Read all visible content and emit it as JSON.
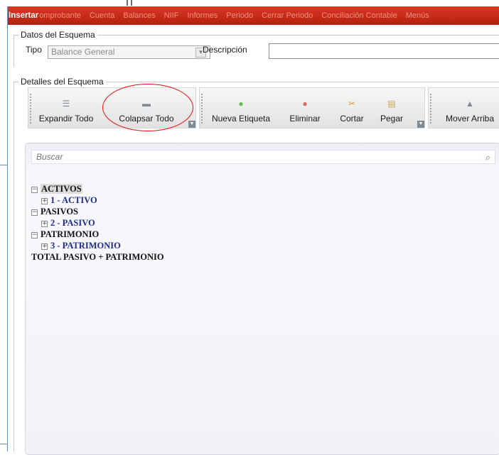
{
  "menubar": {
    "active": "Insertar",
    "items": [
      "omprobante",
      "Cuenta",
      "Balances",
      "NIIF",
      "Informes",
      "Periodo",
      "Cerrar Periodo",
      "Conciliación Contable",
      "Menús"
    ]
  },
  "datos": {
    "title": "Datos del Esquema",
    "tipo_label": "Tipo",
    "tipo_value": "Balance General",
    "descripcion_label": "Descripción",
    "descripcion_value": ""
  },
  "detalles": {
    "title": "Detalles del Esquema",
    "toolbar": {
      "expandir": "Expandir Todo",
      "colapsar": "Colapsar Todo",
      "nueva": "Nueva Etiqueta",
      "eliminar": "Eliminar",
      "cortar": "Cortar",
      "pegar": "Pegar",
      "mover_arriba": "Mover Arriba"
    },
    "search_placeholder": "Buscar",
    "tree": {
      "activos": "ACTIVOS",
      "activo": "1 - ACTIVO",
      "pasivos": "PASIVOS",
      "pasivo": "2 - PASIVO",
      "patrimonio": "PATRIMONIO",
      "patrimonio_child": "3 - PATRIMONIO",
      "total": "TOTAL PASIVO + PATRIMONIO"
    }
  },
  "colors": {
    "menubar": "#c52a15",
    "annotation": "#e81010",
    "tree_child": "#1f2c8f"
  },
  "icons": {
    "collapsed_node": "plus-box",
    "expanded_node": "minus-box"
  }
}
